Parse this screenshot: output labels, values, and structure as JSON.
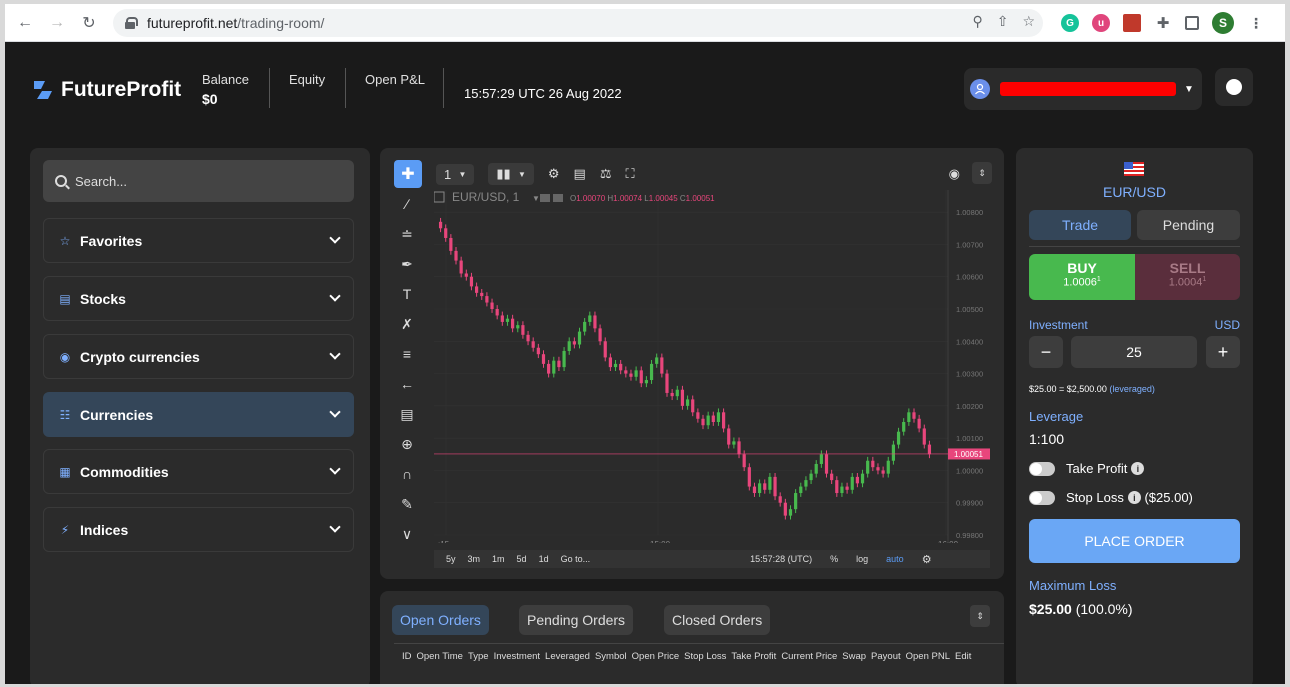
{
  "browser": {
    "url_host": "futureprofit.net",
    "url_path": "/trading-room/",
    "profile_initial": "S"
  },
  "header": {
    "brand": "FutureProfit",
    "balance_label": "Balance",
    "balance_value": "$0",
    "equity_label": "Equity",
    "open_pnl_label": "Open P&L",
    "clock": "15:57:29 UTC 26 Aug 2022"
  },
  "sidebar": {
    "search_placeholder": "Search...",
    "categories": [
      {
        "label": "Favorites",
        "icon": "star-icon"
      },
      {
        "label": "Stocks",
        "icon": "chart-icon"
      },
      {
        "label": "Crypto currencies",
        "icon": "bitcoin-icon"
      },
      {
        "label": "Currencies",
        "icon": "coins-icon",
        "active": true
      },
      {
        "label": "Commodities",
        "icon": "commodities-icon"
      },
      {
        "label": "Indices",
        "icon": "indices-icon"
      }
    ]
  },
  "chart_toolbar": {
    "interval": "1",
    "legend_symbol": "EUR/USD, 1",
    "ohlc": {
      "o": "1.00070",
      "h": "1.00074",
      "l": "1.00045",
      "c": "1.00051"
    },
    "current_price_tag": "1.00051",
    "ranges": [
      "5y",
      "3m",
      "1m",
      "5d",
      "1d",
      "Go to..."
    ],
    "bottom_time": "15:57:28 (UTC)",
    "bottom_pct": "%",
    "bottom_log": "log",
    "bottom_auto": "auto"
  },
  "chart_data": {
    "type": "candlestick",
    "y_ticks": [
      "1.00800",
      "1.00700",
      "1.00600",
      "1.00500",
      "1.00400",
      "1.00300",
      "1.00200",
      "1.00100",
      "1.00000",
      "0.99900",
      "0.99800"
    ],
    "x_ticks": [
      ":15",
      "15:00",
      "16:00"
    ],
    "ylim": [
      0.998,
      1.0085
    ],
    "close_series": [
      1.0075,
      1.0072,
      1.0068,
      1.0065,
      1.0061,
      1.006,
      1.0057,
      1.0055,
      1.0054,
      1.0052,
      1.005,
      1.0048,
      1.0046,
      1.0047,
      1.0044,
      1.0045,
      1.0042,
      1.004,
      1.0038,
      1.0036,
      1.0033,
      1.003,
      1.0034,
      1.0032,
      1.0037,
      1.004,
      1.0039,
      1.0043,
      1.0046,
      1.0048,
      1.0044,
      1.004,
      1.0035,
      1.0032,
      1.0033,
      1.0031,
      1.003,
      1.0029,
      1.0031,
      1.0027,
      1.0028,
      1.0033,
      1.0035,
      1.003,
      1.0024,
      1.0023,
      1.0025,
      1.002,
      1.0022,
      1.0018,
      1.0016,
      1.0014,
      1.0017,
      1.0015,
      1.0018,
      1.0013,
      1.0008,
      1.0009,
      1.0005,
      1.0001,
      0.9995,
      0.9993,
      0.9996,
      0.9994,
      0.9998,
      0.9992,
      0.999,
      0.9986,
      0.9988,
      0.9993,
      0.9995,
      0.9997,
      0.9999,
      1.0002,
      1.0005,
      0.9999,
      0.9997,
      0.9993,
      0.9995,
      0.9994,
      0.9998,
      0.9996,
      0.9999,
      1.0003,
      1.0001,
      1.0,
      0.9999,
      1.0003,
      1.0008,
      1.0012,
      1.0015,
      1.0018,
      1.0016,
      1.0013,
      1.0008,
      1.0005
    ]
  },
  "orders": {
    "tabs": [
      "Open Orders",
      "Pending Orders",
      "Closed Orders"
    ],
    "columns": [
      "ID",
      "Open Time",
      "Type",
      "Investment",
      "Leveraged",
      "Symbol",
      "Open Price",
      "Stop Loss",
      "Take Profit",
      "Current Price",
      "Swap",
      "Payout",
      "Open PNL",
      "Edit"
    ]
  },
  "trade": {
    "pair": "EUR/USD",
    "tab_trade": "Trade",
    "tab_pending": "Pending",
    "buy_label": "BUY",
    "buy_price": "1.0006",
    "buy_sup": "1",
    "sell_label": "SELL",
    "sell_price": "1.0004",
    "sell_sup": "1",
    "investment_label": "Investment",
    "currency": "USD",
    "minus": "−",
    "plus": "+",
    "investment_value": "25",
    "leveraged_note": "$25.00 = $2,500.00",
    "leveraged_tag": "(leveraged)",
    "leverage_label": "Leverage",
    "leverage_value": "1:100",
    "take_profit_label": "Take Profit",
    "stop_loss_label": "Stop Loss",
    "stop_loss_value": "($25.00)",
    "place_order": "PLACE ORDER",
    "max_loss_label": "Maximum Loss",
    "max_loss_value": "$25.00",
    "max_loss_pct": "(100.0%)"
  }
}
